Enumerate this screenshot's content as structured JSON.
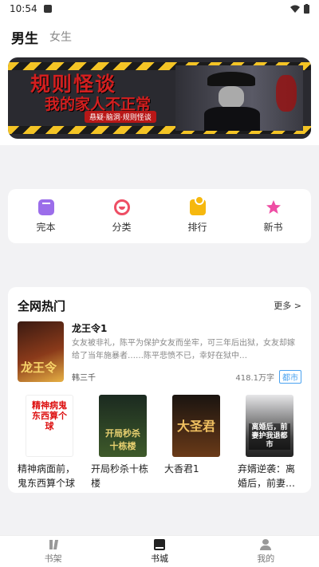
{
  "status": {
    "time": "10:54"
  },
  "gender_tabs": [
    {
      "label": "男生",
      "active": true
    },
    {
      "label": "女生",
      "active": false
    }
  ],
  "banner": {
    "title_line1": "规则怪谈",
    "title_line2": "我的家人不正常",
    "tagline": "悬疑·脑洞·规则怪谈"
  },
  "quick_nav": [
    {
      "label": "完本",
      "icon": "book-icon",
      "color": "#9b6dea"
    },
    {
      "label": "分类",
      "icon": "category-icon",
      "color": "#ee4e64"
    },
    {
      "label": "排行",
      "icon": "rank-icon",
      "color": "#f6b80e"
    },
    {
      "label": "新书",
      "icon": "new-book-icon",
      "color": "#ee4ea4"
    }
  ],
  "hot": {
    "title": "全网热门",
    "more": "更多 >",
    "featured": {
      "cover_text": "龙王令",
      "title": "龙王令1",
      "description": "女友被非礼，陈平为保护女友而坐牢，可三年后出狱，女友却嫁给了当年施暴者……陈平悲愤不已，幸好在狱中…",
      "author": "韩三千",
      "word_count": "418.1万字",
      "tag": "都市"
    },
    "books": [
      {
        "cover_text": "精神病鬼东西算个球",
        "title": "精神病面前，鬼东西算个球"
      },
      {
        "cover_text": "开局秒杀十栋楼",
        "title": "开局秒杀十栋楼"
      },
      {
        "cover_text": "大圣君",
        "title": "大香君1"
      },
      {
        "cover_text": "离婚后，前妻护我退都市",
        "title": "弃婿逆袭：离婚后，前妻…"
      }
    ]
  },
  "tabbar": [
    {
      "label": "书架",
      "icon": "bookshelf-icon",
      "active": false
    },
    {
      "label": "书城",
      "icon": "bookstore-icon",
      "active": true
    },
    {
      "label": "我的",
      "icon": "profile-icon",
      "active": false
    }
  ]
}
